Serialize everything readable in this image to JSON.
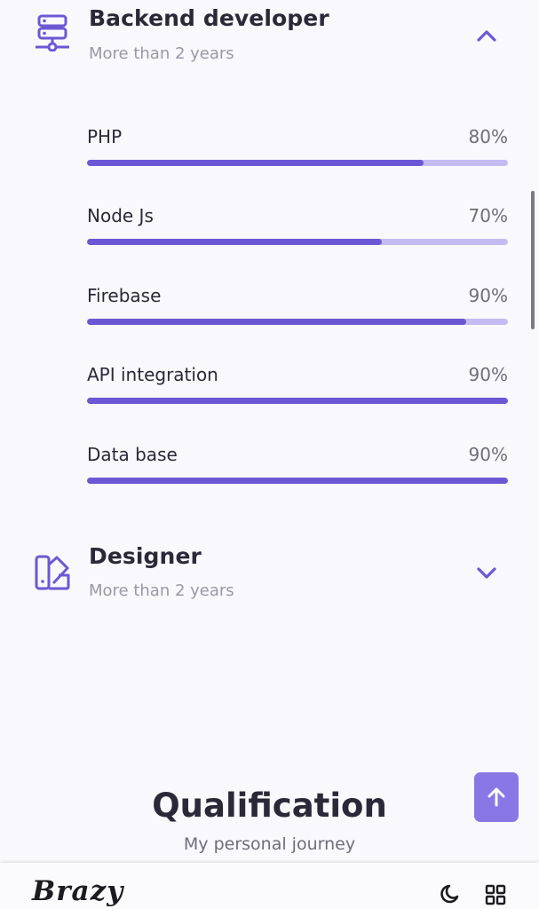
{
  "skills": [
    {
      "title": "Backend developer",
      "subtitle": "More than 2 years",
      "icon": "server-icon",
      "expanded": true,
      "items": [
        {
          "name": "PHP",
          "percent_label": "80%",
          "percent": 80
        },
        {
          "name": "Node Js",
          "percent_label": "70%",
          "percent": 70
        },
        {
          "name": "Firebase",
          "percent_label": "90%",
          "percent": 90
        },
        {
          "name": "API integration",
          "percent_label": "90%",
          "percent": 100
        },
        {
          "name": "Data base",
          "percent_label": "90%",
          "percent": 100
        }
      ]
    },
    {
      "title": "Designer",
      "subtitle": "More than 2 years",
      "icon": "swatchbook-icon",
      "expanded": false
    }
  ],
  "qualification": {
    "title": "Qualification",
    "subtitle": "My personal journey"
  },
  "nav": {
    "logo": "Brazy",
    "theme_icon": "moon-icon",
    "menu_icon": "grid-icon"
  },
  "colors": {
    "accent": "#6c58d4",
    "accent_light": "#c3bbf1",
    "button": "#8a77e6"
  }
}
